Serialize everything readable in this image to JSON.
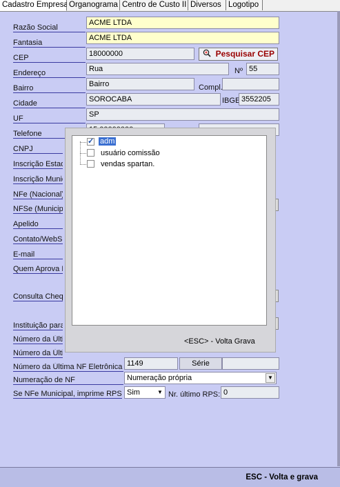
{
  "tabs": [
    {
      "label": "Cadastro Empresa"
    },
    {
      "label": "Organograma"
    },
    {
      "label": "Centro de Custo II"
    },
    {
      "label": "Diversos"
    },
    {
      "label": "Logotipo"
    }
  ],
  "form": {
    "razao_social": {
      "label": "Razão Social",
      "value": "ACME LTDA"
    },
    "fantasia": {
      "label": "Fantasia",
      "value": "ACME LTDA"
    },
    "cep": {
      "label": "CEP",
      "value": "18000000",
      "button": "Pesquisar CEP"
    },
    "endereco": {
      "label": "Endereço",
      "value": "Rua",
      "numero_label": "Nº",
      "numero_value": "55"
    },
    "bairro": {
      "label": "Bairro",
      "value": "Bairro",
      "compl_label": "Compl.",
      "compl_value": ""
    },
    "cidade": {
      "label": "Cidade",
      "value": "SOROCABA",
      "ibge_label": "IBGE",
      "ibge_value": "3552205"
    },
    "uf": {
      "label": "UF",
      "value": "SP"
    },
    "telefone": {
      "label": "Telefone",
      "value": "15 00000000"
    },
    "cnpj": {
      "label": "CNPJ"
    },
    "inscricao_estadual": {
      "label": "Inscrição Estad"
    },
    "inscricao_municipal": {
      "label": "Inscrição Munic"
    },
    "nfe_nacional": {
      "label": "NFe (Nacional)"
    },
    "nfse_municipal": {
      "label": "NFSe (Municipa"
    },
    "apelido": {
      "label": "Apelido"
    },
    "contato_website": {
      "label": "Contato/WebSit"
    },
    "email": {
      "label": "E-mail"
    },
    "quem_aprova": {
      "label": "Quem Aprova L"
    },
    "consulta_cheque": {
      "label": "Consulta Chequ"
    },
    "instituicao": {
      "label": "Instituição para"
    },
    "numero_ultima_1": {
      "label": "Número da Últim"
    },
    "numero_ultima_2": {
      "label": "Número da Últim"
    },
    "ultima_nf_eletronica": {
      "label": "Número da Última NF Eletrônica",
      "value": "1149",
      "serie_label": "Série"
    },
    "numeracao_nf": {
      "label": "Numeração de NF",
      "value": "Numeração própria"
    },
    "imprime_rps": {
      "label": "Se NFe Municipal, imprime RPS?",
      "value": "Sim",
      "ultimo_rps_label": "Nr. último RPS:",
      "ultimo_rps_value": "0"
    }
  },
  "popup": {
    "items": [
      {
        "label": "adm",
        "checked": true,
        "selected": true
      },
      {
        "label": "usuário comissão",
        "checked": false
      },
      {
        "label": "vendas spartan.",
        "checked": false
      }
    ],
    "footer": "<ESC> - Volta Grava"
  },
  "footer": {
    "esc_label": "ESC - Volta e grava"
  },
  "colors": {
    "panel_bg": "#c9ccf4",
    "field_bg": "#e9ecf1",
    "yellow_field": "#ffffcc",
    "cep_button_text": "#990000",
    "selection": "#3a6fd1"
  }
}
